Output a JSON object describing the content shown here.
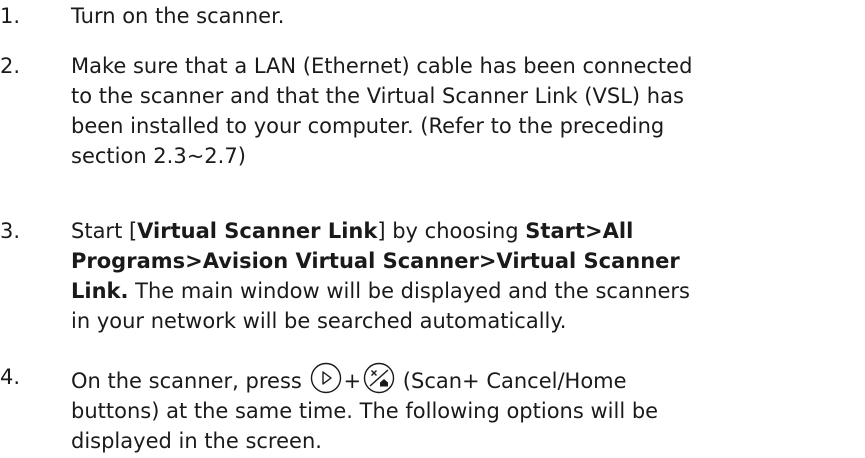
{
  "steps": [
    {
      "num": "1.",
      "text": "Turn on the scanner."
    },
    {
      "num": "2.",
      "lines": [
        "Make sure that a LAN (Ethernet) cable has been connected",
        "to the scanner and that the Virtual Scanner Link (VSL) has",
        "been installed to your computer. (Refer to the preceding",
        "section 2.3~2.7)"
      ]
    },
    {
      "num": "3.",
      "l1a": "Start [",
      "l1b": "Virtual Scanner Link",
      "l1c": "] by choosing ",
      "l1d": "Start>All",
      "l2": "Programs>Avision Virtual Scanner>Virtual Scanner",
      "l3a": "Link.",
      "l3b": " The main window will be displayed and the scanners",
      "l4": "in your network will be searched automatically."
    },
    {
      "num": "4.",
      "l1a": "On the scanner, press ",
      "plus": "+",
      "l1b": " (Scan+ Cancel/Home",
      "l2": "buttons) at the same time. The following options will be",
      "l3": "displayed in the screen.",
      "icons": [
        "scan-icon",
        "cancel-home-icon"
      ]
    }
  ]
}
